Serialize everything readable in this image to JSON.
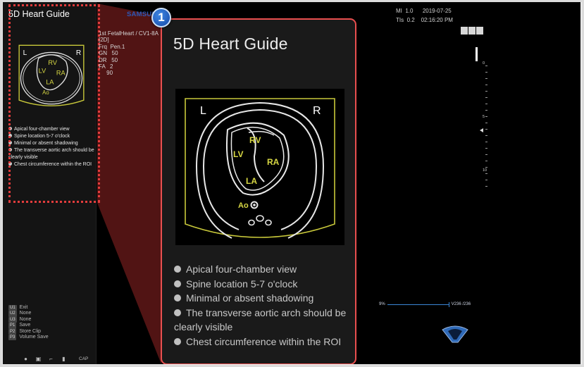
{
  "guide": {
    "title": "5D Heart Guide",
    "badge_number": "1",
    "diagram": {
      "left": "L",
      "right": "R",
      "labels": [
        "RV",
        "LV",
        "RA",
        "LA",
        "Ao"
      ]
    },
    "bullets": [
      "Apical four-chamber view",
      "Spine location 5-7 o'clock",
      "Minimal or absent shadowing",
      "The transverse aortic arch should be clearly visible",
      "Chest circumference within the ROI"
    ]
  },
  "header": {
    "brand": "SAMSUNG",
    "preset_info": "1st FetalHeart / CV1-8A\n[2D]\nFrq  Pen.1\nGN   50\nDR   50\nFA   2\n     90",
    "mi_label": "MI",
    "mi_value": "1.0",
    "tis_label": "TIs",
    "tis_value": "0.2",
    "date": "2019-07-25",
    "time": "02:16:20 PM"
  },
  "scale": {
    "top_mark": "0",
    "mid_mark": "5",
    "low_mark": "10"
  },
  "cine": {
    "start": "9%",
    "end": "V236 /236",
    "position": 1.0
  },
  "keys": [
    {
      "key": "U1",
      "label": "Exit"
    },
    {
      "key": "U2",
      "label": "None"
    },
    {
      "key": "U3",
      "label": "None"
    },
    {
      "key": "P1",
      "label": "Save"
    },
    {
      "key": "P2",
      "label": "Store Clip"
    },
    {
      "key": "P3",
      "label": "Volume Save"
    }
  ],
  "footer": {
    "cap_label": "CAP",
    "icons": [
      "circle-icon",
      "monitor-icon",
      "pointer-icon",
      "battery-icon"
    ]
  },
  "colors": {
    "callout_border": "#e94f4f",
    "badge": "#1f5fc4",
    "diagram_outline": "#c8c83a",
    "diagram_label": "#d8d844",
    "cine_line": "#3b86d6"
  }
}
